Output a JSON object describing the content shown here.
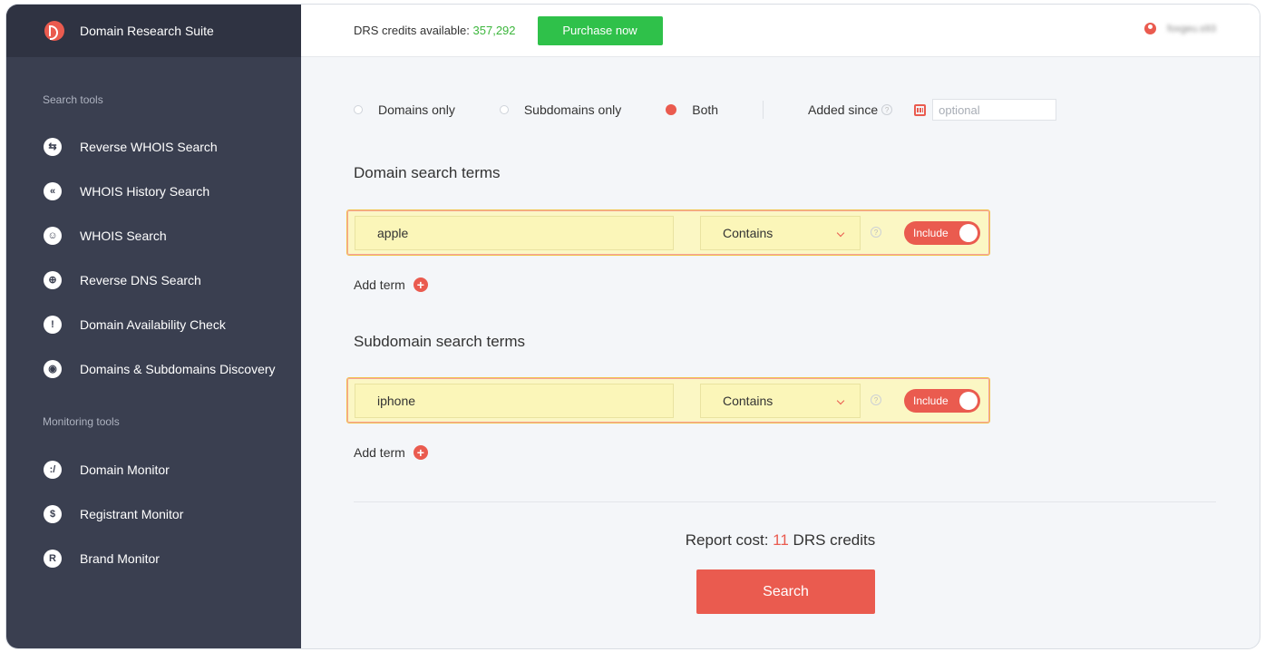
{
  "app": {
    "title": "Domain Research Suite"
  },
  "header": {
    "credits_label": "DRS credits available:",
    "credits_value": "357,292",
    "purchase_label": "Purchase now",
    "user_name": "foxgeu.s93"
  },
  "sidebar": {
    "search_tools_title": "Search tools",
    "search_items": [
      {
        "label": "Reverse WHOIS Search",
        "icon": "reverse-whois-icon"
      },
      {
        "label": "WHOIS History Search",
        "icon": "history-icon"
      },
      {
        "label": "WHOIS Search",
        "icon": "whois-icon"
      },
      {
        "label": "Reverse DNS Search",
        "icon": "globe-icon"
      },
      {
        "label": "Domain Availability Check",
        "icon": "exclamation-icon"
      },
      {
        "label": "Domains & Subdomains Discovery",
        "icon": "discovery-icon"
      }
    ],
    "monitoring_tools_title": "Monitoring tools",
    "monitoring_items": [
      {
        "label": "Domain Monitor",
        "icon": "domain-monitor-icon"
      },
      {
        "label": "Registrant Monitor",
        "icon": "registrant-monitor-icon"
      },
      {
        "label": "Brand Monitor",
        "icon": "brand-monitor-icon"
      }
    ]
  },
  "filters": {
    "options": [
      "Domains only",
      "Subdomains only",
      "Both"
    ],
    "selected": "Both",
    "added_since_label": "Added since",
    "added_since_placeholder": "optional"
  },
  "domain_terms": {
    "heading": "Domain search terms",
    "term": "apple",
    "match": "Contains",
    "toggle": "Include",
    "add_term": "Add term"
  },
  "subdomain_terms": {
    "heading": "Subdomain search terms",
    "term": "iphone",
    "match": "Contains",
    "toggle": "Include",
    "add_term": "Add term"
  },
  "report": {
    "cost_prefix": "Report cost:",
    "cost_value": "11",
    "cost_suffix": "DRS credits",
    "search_label": "Search"
  },
  "colors": {
    "accent": "#ea5b4f",
    "sidebar": "#3a3f50",
    "purchase": "#2fc14a"
  }
}
